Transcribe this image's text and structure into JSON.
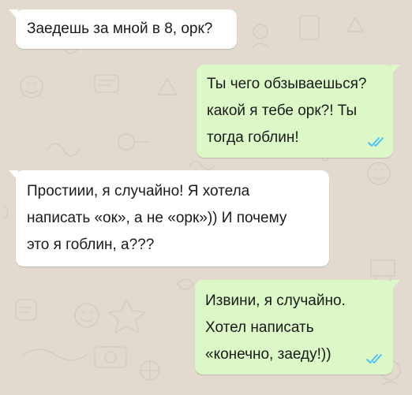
{
  "chat": {
    "background_color": "#e2dacf",
    "incoming_bubble_color": "#ffffff",
    "outgoing_bubble_color": "#dcf8c6",
    "read_receipt_color": "#4fc3f7",
    "messages": [
      {
        "direction": "incoming",
        "lines": [
          "Заедешь за мной в 8, орк?"
        ]
      },
      {
        "direction": "outgoing",
        "lines": [
          "Ты чего обзываешься?",
          "какой я тебе орк?! Ты",
          "тогда гоблин!"
        ],
        "status_icon": "double-check-read-icon"
      },
      {
        "direction": "incoming",
        "lines": [
          "Простиии, я случайно! Я хотела",
          "написать «ок», а не «орк»)) И почему",
          "это я гоблин, а???"
        ]
      },
      {
        "direction": "outgoing",
        "lines": [
          "Извини, я случайно.",
          "Хотел написать",
          "«конечно, заеду!))"
        ],
        "status_icon": "double-check-read-icon"
      }
    ]
  }
}
